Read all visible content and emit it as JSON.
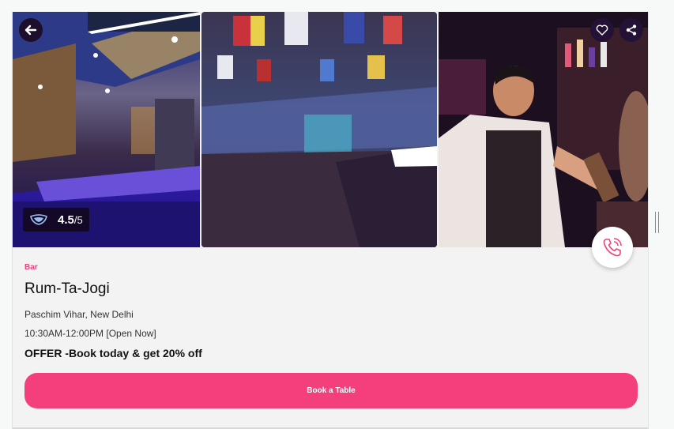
{
  "listing": {
    "category": "Bar",
    "name": "Rum-Ta-Jogi",
    "location": "Paschim Vihar, New Delhi",
    "hours": "10:30AM-12:00PM [Open Now]",
    "offer": "OFFER -Book today & get 20% off"
  },
  "rating": {
    "value": "4.5",
    "scale": "/5"
  },
  "actions": {
    "book_label": "Book a Table"
  },
  "icons": [
    "back-arrow-icon",
    "heart-icon",
    "share-icon",
    "rating-logo-icon",
    "phone-call-icon"
  ],
  "colors": {
    "accent": "#f43f7d",
    "dark_button": "#231235",
    "category_text": "#e8457f"
  }
}
